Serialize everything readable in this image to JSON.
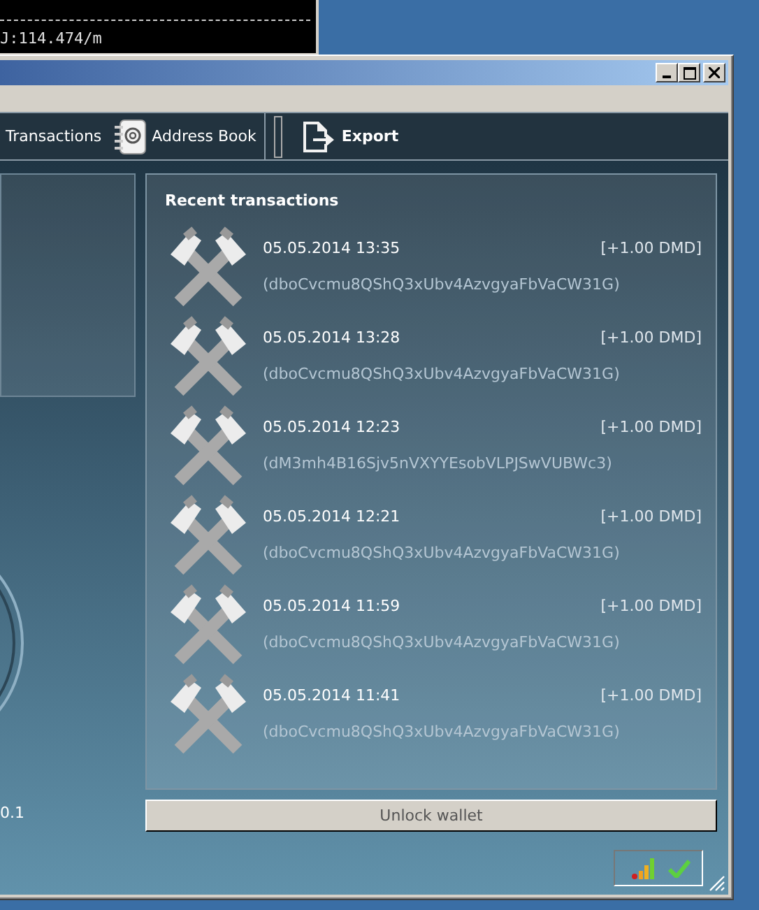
{
  "console_window": {
    "text": "J:114.474/m"
  },
  "toolbar": {
    "items": [
      {
        "label": "Transactions"
      },
      {
        "label": "Address Book"
      },
      {
        "label": "Export"
      }
    ]
  },
  "overview": {
    "version_text": "0.1"
  },
  "recent_transactions": {
    "title": "Recent transactions",
    "items": [
      {
        "kind": "mined",
        "date": "05.05.2014 13:35",
        "amount": "[+1.00 DMD]",
        "address": "(dboCvcmu8QShQ3xUbv4AzvgyaFbVaCW31G)"
      },
      {
        "kind": "mined",
        "date": "05.05.2014 13:28",
        "amount": "[+1.00 DMD]",
        "address": "(dboCvcmu8QShQ3xUbv4AzvgyaFbVaCW31G)"
      },
      {
        "kind": "mined",
        "date": "05.05.2014 12:23",
        "amount": "[+1.00 DMD]",
        "address": "(dM3mh4B16Sjv5nVXYYEsobVLPJSwVUBWc3)"
      },
      {
        "kind": "mined",
        "date": "05.05.2014 12:21",
        "amount": "[+1.00 DMD]",
        "address": "(dboCvcmu8QShQ3xUbv4AzvgyaFbVaCW31G)"
      },
      {
        "kind": "mined",
        "date": "05.05.2014 11:59",
        "amount": "[+1.00 DMD]",
        "address": "(dboCvcmu8QShQ3xUbv4AzvgyaFbVaCW31G)"
      },
      {
        "kind": "mined",
        "date": "05.05.2014 11:41",
        "amount": "[+1.00 DMD]",
        "address": "(dboCvcmu8QShQ3xUbv4AzvgyaFbVaCW31G)"
      }
    ]
  },
  "unlock_button": {
    "label": "Unlock wallet"
  },
  "status_bar": {
    "synced": true
  }
}
